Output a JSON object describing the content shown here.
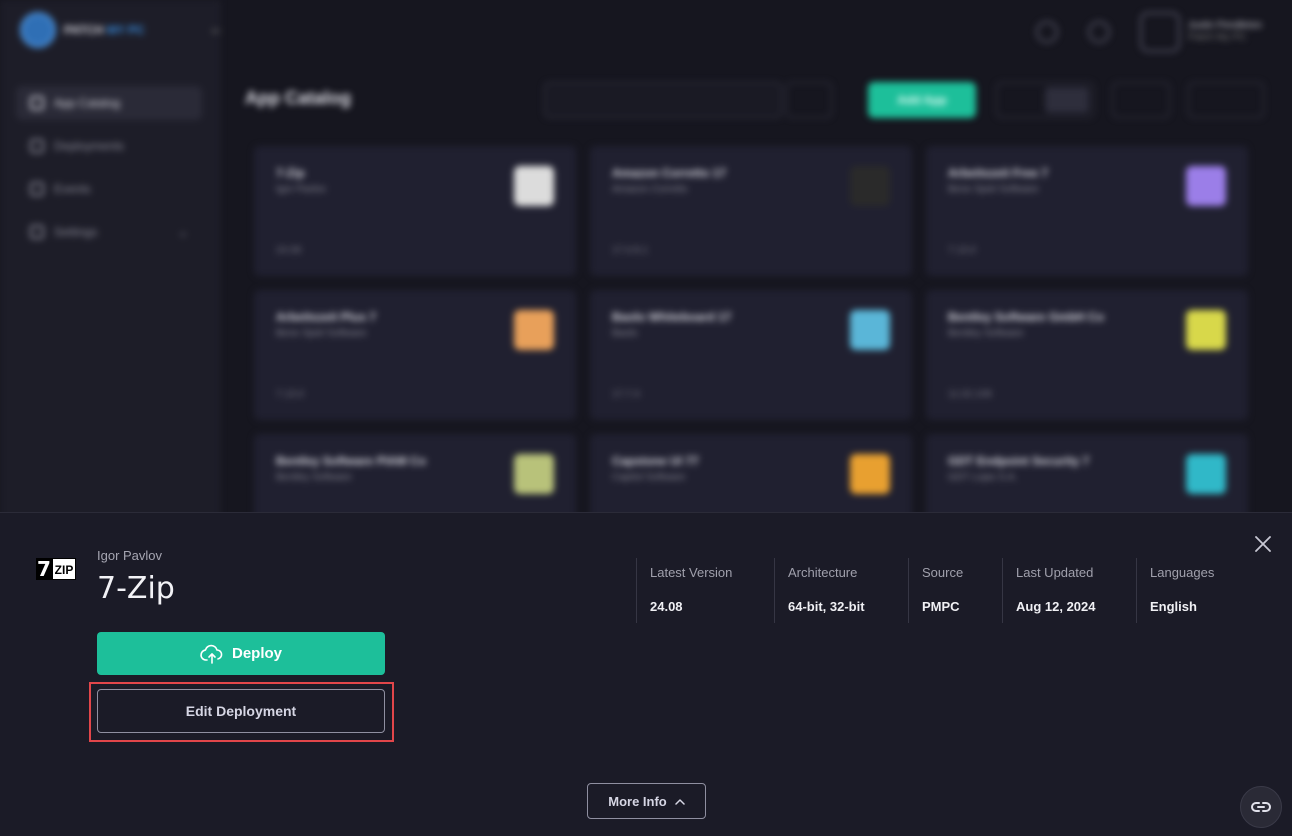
{
  "background": {
    "logo_text_a": "PATCH",
    "logo_text_b": "MY PC",
    "nav": [
      {
        "label": "App Catalog",
        "active": true
      },
      {
        "label": "Deployments"
      },
      {
        "label": "Events"
      },
      {
        "label": "Settings"
      }
    ],
    "user": {
      "name": "Justin Pendleton",
      "sub": "Patch My PC"
    },
    "page_title": "App Catalog",
    "add_app_label": "Add App",
    "cards": [
      {
        "name": "7-Zip",
        "publisher": "Igor Pavlov",
        "version": "24.08",
        "icon_color": "#dcdcdc"
      },
      {
        "name": "Amazon Corretto 17",
        "publisher": "Amazon Corretto",
        "version": "17.0.8.1",
        "icon_color": "#2a2a2a"
      },
      {
        "name": "Arbeitszeit Free 7",
        "publisher": "Bene Spiel Software",
        "version": "7.13.0",
        "icon_color": "#9b7ee8"
      },
      {
        "name": "Arbeitszeit Plus 7",
        "publisher": "Bene Spiel Software",
        "version": "7.13.0",
        "icon_color": "#e8a05a"
      },
      {
        "name": "Baolo Whiteboard 17",
        "publisher": "Baolo",
        "version": "17.7.4",
        "icon_color": "#5ab6d8"
      },
      {
        "name": "Bentley Software GmbH Co",
        "publisher": "Bentley Software",
        "version": "11.02.108",
        "icon_color": "#d8d84a"
      },
      {
        "name": "Bentley Software PIAM Co",
        "publisher": "Bentley Software",
        "version": "",
        "icon_color": "#b8c27a"
      },
      {
        "name": "Capstone UI 77",
        "publisher": "Capitol Software",
        "version": "",
        "icon_color": "#e8a030"
      },
      {
        "name": "GDT Endpoint Security 7",
        "publisher": "GDT Lojas S.A.",
        "version": "",
        "icon_color": "#30b8c8"
      }
    ]
  },
  "detail": {
    "publisher": "Igor Pavlov",
    "name": "7-Zip",
    "logo_seven": "7",
    "logo_zip": "ZIP",
    "deploy_label": "Deploy",
    "edit_label": "Edit Deployment",
    "more_info_label": "More Info",
    "meta": [
      {
        "label": "Latest Version",
        "value": "24.08"
      },
      {
        "label": "Architecture",
        "value": "64-bit, 32-bit"
      },
      {
        "label": "Source",
        "value": "PMPC"
      },
      {
        "label": "Last Updated",
        "value": "Aug 12, 2024"
      },
      {
        "label": "Languages",
        "value": "English"
      }
    ]
  },
  "colors": {
    "accent": "#1dbf9a",
    "highlight": "#e2464a",
    "panel_bg": "#1b1b27"
  }
}
